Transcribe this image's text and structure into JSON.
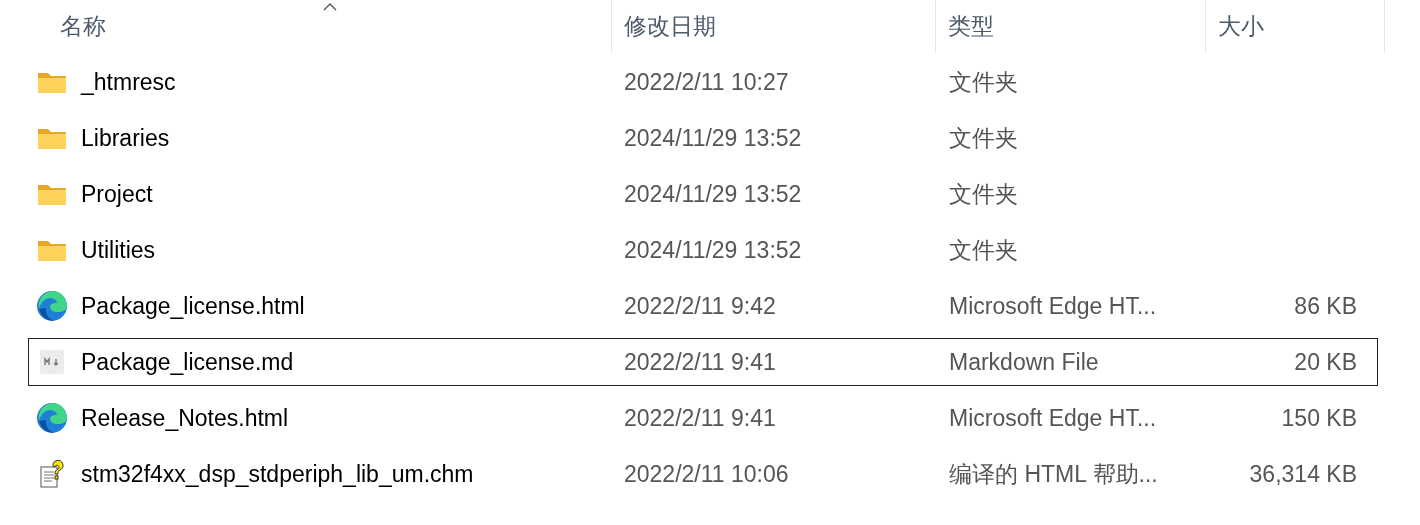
{
  "columns": [
    {
      "label": "名称",
      "sorted": true
    },
    {
      "label": "修改日期",
      "sorted": false
    },
    {
      "label": "类型",
      "sorted": false
    },
    {
      "label": "大小",
      "sorted": false
    }
  ],
  "rows": [
    {
      "kind": "folder",
      "name": "_htmresc",
      "date": "2022/2/11 10:27",
      "type": "文件夹",
      "focused": false
    },
    {
      "kind": "folder",
      "name": "Libraries",
      "date": "2024/11/29 13:52",
      "type": "文件夹",
      "focused": false
    },
    {
      "kind": "folder",
      "name": "Project",
      "date": "2024/11/29 13:52",
      "type": "文件夹",
      "focused": false
    },
    {
      "kind": "folder",
      "name": "Utilities",
      "date": "2024/11/29 13:52",
      "type": "文件夹",
      "focused": false
    },
    {
      "kind": "edge",
      "name": "Package_license.html",
      "date": "2022/2/11 9:42",
      "type": "Microsoft Edge HT...",
      "size": "86 KB",
      "focused": false
    },
    {
      "kind": "markdown",
      "name": "Package_license.md",
      "date": "2022/2/11 9:41",
      "type": "Markdown File",
      "size": "20 KB",
      "focused": true
    },
    {
      "kind": "edge",
      "name": "Release_Notes.html",
      "date": "2022/2/11 9:41",
      "type": "Microsoft Edge HT...",
      "size": "150 KB",
      "focused": false
    },
    {
      "kind": "help",
      "name": "stm32f4xx_dsp_stdperiph_lib_um.chm",
      "date": "2022/2/11 10:06",
      "type": "编译的 HTML 帮助...",
      "size": "36,314 KB",
      "focused": false
    }
  ]
}
